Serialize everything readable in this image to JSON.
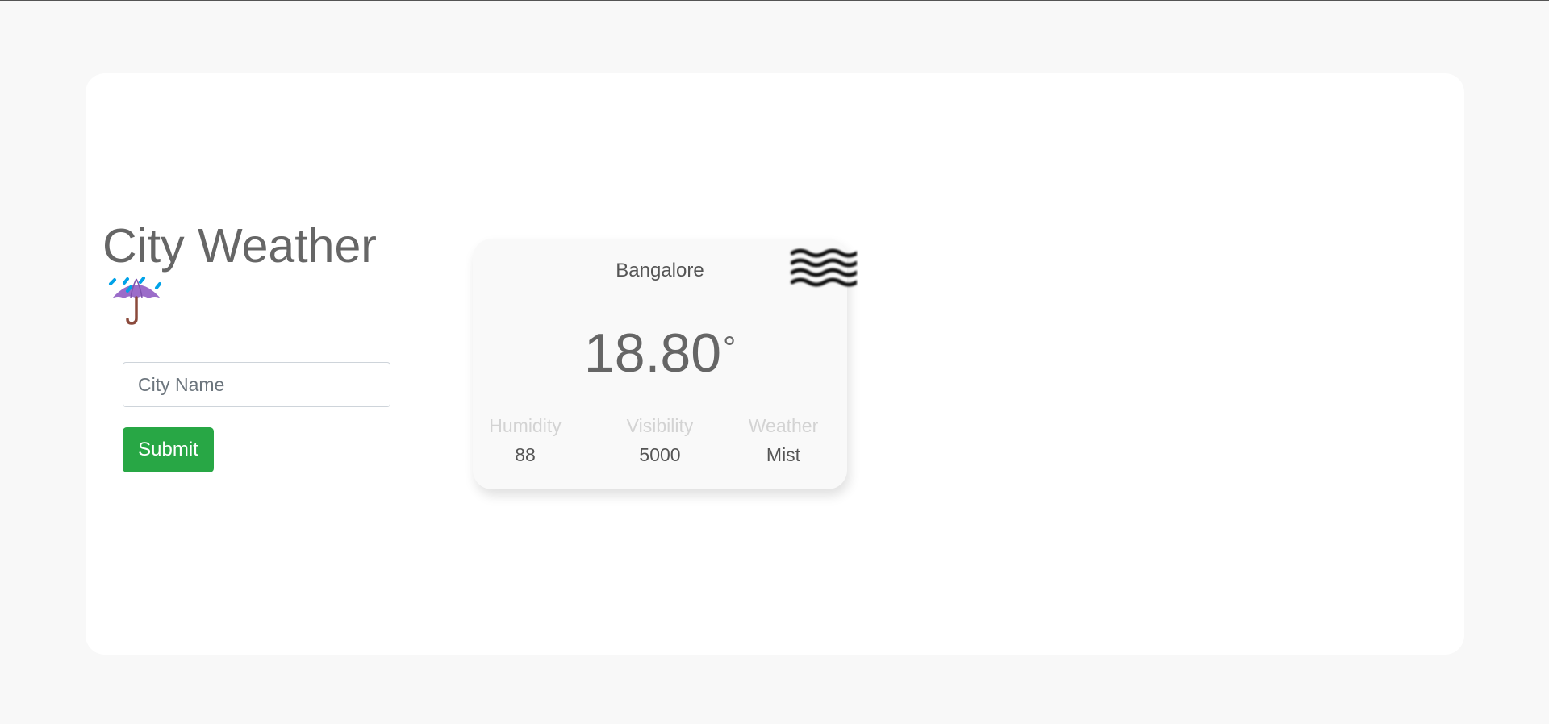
{
  "app": {
    "title": "City Weather"
  },
  "form": {
    "city_placeholder": "City Name",
    "city_value": "",
    "submit_label": "Submit"
  },
  "weather": {
    "city": "Bangalore",
    "temperature": "18.80",
    "degree_symbol": "°",
    "icon": "fog-icon",
    "stats": [
      {
        "label": "Humidity",
        "value": "88"
      },
      {
        "label": "Visibility",
        "value": "5000"
      },
      {
        "label": "Weather",
        "value": "Mist"
      }
    ]
  },
  "icons": {
    "title_icon": "umbrella-rain-icon"
  },
  "colors": {
    "submit_button": "#28a745",
    "background": "#f8f8f8",
    "panel": "#ffffff",
    "card": "#f9f9f9",
    "title_text": "#666666",
    "stat_label": "#d3d3d3"
  }
}
